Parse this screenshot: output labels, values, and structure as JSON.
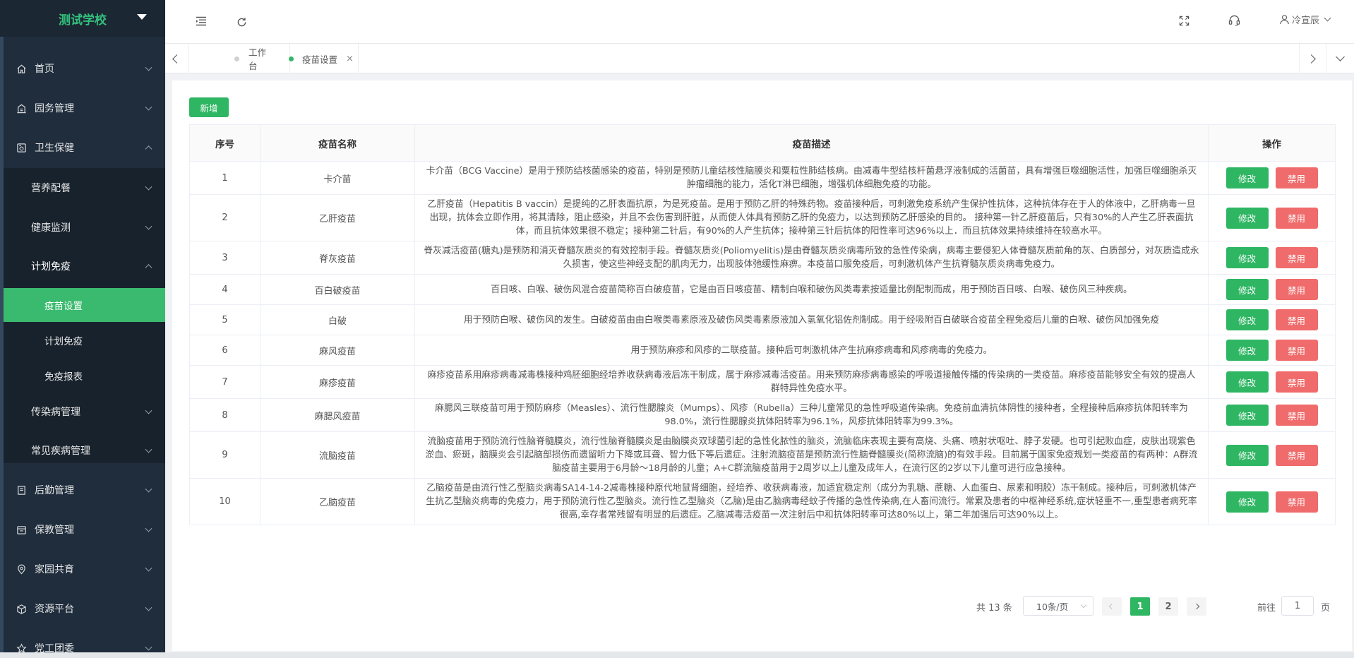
{
  "sidebar": {
    "logo": "测试学校",
    "items": [
      {
        "label": "首页"
      },
      {
        "label": "园务管理"
      },
      {
        "label": "卫生保健"
      },
      {
        "label": "营养配餐"
      },
      {
        "label": "健康监测"
      },
      {
        "label": "计划免疫"
      },
      {
        "label": "疫苗设置"
      },
      {
        "label": "计划免疫"
      },
      {
        "label": "免疫报表"
      },
      {
        "label": "传染病管理"
      },
      {
        "label": "常见疾病管理"
      },
      {
        "label": "后勤管理"
      },
      {
        "label": "保教管理"
      },
      {
        "label": "家园共育"
      },
      {
        "label": "资源平台"
      },
      {
        "label": "党工团委"
      }
    ]
  },
  "header": {
    "user": "冷宣辰"
  },
  "tabs": [
    {
      "label": "工作台"
    },
    {
      "label": "疫苗设置"
    }
  ],
  "toolbar": {
    "add_label": "新增"
  },
  "table": {
    "columns": [
      "序号",
      "疫苗名称",
      "疫苗描述",
      "操作"
    ],
    "edit_label": "修改",
    "disable_label": "禁用",
    "rows": [
      {
        "no": "1",
        "name": "卡介苗",
        "desc": "卡介苗（BCG Vaccine）是用于预防结核菌感染的疫苗，特别是预防儿童结核性脑膜炎和粟粒性肺结核病。由减毒牛型结核杆菌悬浮液制成的活菌苗，具有增强巨噬细胞活性，加强巨噬细胞杀灭肿瘤细胞的能力，活化T淋巴细胞，增强机体细胞免疫的功能。"
      },
      {
        "no": "2",
        "name": "乙肝疫苗",
        "desc": "乙肝疫苗（Hepatitis B vaccin）是提纯的乙肝表面抗原，为是死疫苗。是用于预防乙肝的特殊药物。疫苗接种后，可刺激免疫系统产生保护性抗体，这种抗体存在于人的体液中，乙肝病毒一旦出现，抗体会立即作用，将其清除，阻止感染，并且不会伤害到肝脏，从而使人体具有预防乙肝的免疫力，以达到预防乙肝感染的目的。 接种第一针乙肝疫苗后，只有30%的人产生乙肝表面抗体，而且抗体效果很不稳定；接种第二针后，有90%的人产生抗体；接种第三针后抗体的阳性率可达96%以上．而且抗体效果持续维持在较高水平。"
      },
      {
        "no": "3",
        "name": "脊灰疫苗",
        "desc": "脊灰减活疫苗(糖丸)是预防和消灭脊髓灰质炎的有效控制手段。脊髓灰质炎(Poliomyelitis)是由脊髓灰质炎病毒所致的急性传染病，病毒主要侵犯人体脊髓灰质前角的灰、白质部分，对灰质造成永久损害，使这些神经支配的肌肉无力，出现肢体弛缓性麻痹。本疫苗口服免疫后，可刺激机体产生抗脊髓灰质炎病毒免疫力。"
      },
      {
        "no": "4",
        "name": "百白破疫苗",
        "desc": "百日咳、白喉、破伤风混合疫苗简称百白破疫苗，它是由百日咳疫苗、精制白喉和破伤风类毒素按适量比例配制而成，用于预防百日咳、白喉、破伤风三种疾病。"
      },
      {
        "no": "5",
        "name": "白破",
        "desc": "用于预防白喉、破伤风的发生。白破疫苗由由白喉类毒素原液及破伤风类毒素原液加入氢氧化铝佐剂制成。用于经吸附百白破联合疫苗全程免疫后儿童的白喉、破伤风加强免疫"
      },
      {
        "no": "6",
        "name": "麻风疫苗",
        "desc": "用于预防麻疹和风疹的二联疫苗。接种后可刺激机体产生抗麻疹病毒和风疹病毒的免疫力。"
      },
      {
        "no": "7",
        "name": "麻疹疫苗",
        "desc": "麻疹疫苗系用麻疹病毒减毒株接种鸡胚细胞经培养收获病毒液后冻干制成，属于麻疹减毒活疫苗。用来预防麻疹病毒感染的呼吸道接触传播的传染病的一类疫苗。麻疹疫苗能够安全有效的提高人群特异性免疫水平。"
      },
      {
        "no": "8",
        "name": "麻腮风疫苗",
        "desc": "麻腮风三联疫苗可用于预防麻疹（Measles）、流行性腮腺炎（Mumps）、风疹（Rubella）三种儿童常见的急性呼吸道传染病。免疫前血清抗体阴性的接种者，全程接种后麻疹抗体阳转率为98.0%，流行性腮腺炎抗体阳转率为96.1%，风疹抗体阳转率为99.3%。"
      },
      {
        "no": "9",
        "name": "流脑疫苗",
        "desc": "流脑疫苗用于预防流行性脑脊髓膜炎，流行性脑脊髓膜炎是由脑膜炎双球菌引起的急性化脓性的脑炎，流脑临床表现主要有高烧、头痛、喷射状呕吐、脖子发硬。也可引起败血症，皮肤出现紫色淤血、瘀斑，脑膜炎会引起脑部损伤而遗留听力下降或耳聋、智力低下等后遗症。注射流脑疫苗是预防流行性脑脊髓膜炎(简称流脑)的有效手段。目前属于国家免疫规划一类疫苗的有两种：A群流脑疫苗主要用于6月龄～18月龄的儿童；A+C群流脑疫苗用于2周岁以上儿童及成年人，在流行区的2岁以下儿童可进行应急接种。"
      },
      {
        "no": "10",
        "name": "乙脑疫苗",
        "desc": "乙脑疫苗是由流行性乙型脑炎病毒SA14-14-2减毒株接种原代地鼠肾细胞，经培养、收获病毒液，加适宜稳定剂（成分为乳糖、蔗糖、人血蛋白、尿素和明胶）冻干制成。接种后，可刺激机体产生抗乙型脑炎病毒的免疫力，用于预防流行性乙型脑炎。流行性乙型脑炎（乙脑)是由乙脑病毒经蚊子传播的急性传染病,在人畜间流行。常累及患者的中枢神经系统,症状轻重不一,重型患者病死率很高,幸存者常残留有明显的后遗症。乙脑减毒活疫苗一次注射后中和抗体阳转率可达80%以上，第二年加强后可达90%以上。"
      }
    ]
  },
  "pagination": {
    "total": "共 13 条",
    "page_size": "10条/页",
    "pages": [
      "1",
      "2"
    ],
    "goto_prefix": "前往",
    "goto_value": "1",
    "goto_suffix": "页"
  },
  "colors": {
    "accent": "#2fb663",
    "danger": "#f06b6b",
    "sidebar": "#1f2d3d"
  }
}
